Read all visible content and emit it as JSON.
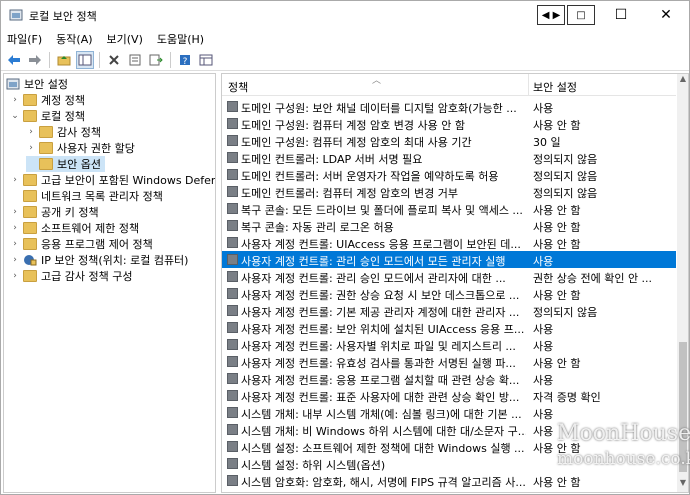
{
  "window": {
    "title": "로컬 보안 정책"
  },
  "titlebar_buttons": {
    "arrows": "◀ ▶",
    "maximize_box": "□",
    "minimize": "—",
    "maximize": "☐",
    "close": "✕"
  },
  "menu": [
    "파일(F)",
    "동작(A)",
    "보기(V)",
    "도움말(H)"
  ],
  "toolbar_icons": [
    "back-icon",
    "forward-icon",
    "up-folder-icon",
    "show-tree-icon",
    "delete-icon",
    "properties-icon",
    "export-icon",
    "help-icon",
    "view-icon"
  ],
  "tree": [
    {
      "label": "보안 설정",
      "level": 0,
      "exp": "",
      "icon": "security-icon"
    },
    {
      "label": "계정 정책",
      "level": 1,
      "exp": "›",
      "icon": "folder-icon"
    },
    {
      "label": "로컬 정책",
      "level": 1,
      "exp": "⌄",
      "icon": "folder-icon"
    },
    {
      "label": "감사 정책",
      "level": 2,
      "exp": "›",
      "icon": "folder-icon"
    },
    {
      "label": "사용자 권한 할당",
      "level": 2,
      "exp": "›",
      "icon": "folder-icon"
    },
    {
      "label": "보안 옵션",
      "level": 2,
      "exp": "",
      "icon": "folder-icon",
      "selected": true
    },
    {
      "label": "고급 보안이 포함된 Windows Defende",
      "level": 1,
      "exp": "›",
      "icon": "folder-icon"
    },
    {
      "label": "네트워크 목록 관리자 정책",
      "level": 1,
      "exp": "",
      "icon": "folder-icon"
    },
    {
      "label": "공개 키 정책",
      "level": 1,
      "exp": "›",
      "icon": "folder-icon"
    },
    {
      "label": "소프트웨어 제한 정책",
      "level": 1,
      "exp": "›",
      "icon": "folder-icon"
    },
    {
      "label": "응용 프로그램 제어 정책",
      "level": 1,
      "exp": "›",
      "icon": "folder-icon"
    },
    {
      "label": "IP 보안 정책(위치: 로컬 컴퓨터)",
      "level": 1,
      "exp": "›",
      "icon": "ip-security-icon"
    },
    {
      "label": "고급 감사 정책 구성",
      "level": 1,
      "exp": "›",
      "icon": "folder-icon"
    }
  ],
  "list": {
    "columns": [
      "정책",
      "보안 설정"
    ],
    "rows": [
      {
        "policy": "도메인 구성원: 보안 채널 데이터를 디지털 암호화(가능한 ...",
        "setting": "사용"
      },
      {
        "policy": "도메인 구성원: 컴퓨터 계정 암호 변경 사용 안 함",
        "setting": "사용 안 함"
      },
      {
        "policy": "도메인 구성원: 컴퓨터 계정 암호의 최대 사용 기간",
        "setting": "30 일"
      },
      {
        "policy": "도메인 컨트롤러: LDAP 서버 서명 필요",
        "setting": "정의되지 않음"
      },
      {
        "policy": "도메인 컨트롤러: 서버 운영자가 작업을 예약하도록 허용",
        "setting": "정의되지 않음"
      },
      {
        "policy": "도메인 컨트롤러: 컴퓨터 계정 암호의 변경 거부",
        "setting": "정의되지 않음"
      },
      {
        "policy": "복구 콘솔: 모든 드라이브 및 폴더에 플로피 복사 및 액세스 ...",
        "setting": "사용 안 함"
      },
      {
        "policy": "복구 콘솔: 자동 관리 로그온 허용",
        "setting": "사용 안 함"
      },
      {
        "policy": "사용자 계정 컨트롤: UIAccess 응용 프로그램이 보안된 데...",
        "setting": "사용 안 함"
      },
      {
        "policy": "사용자 계정 컨트롤: 관리 승인 모드에서 모든 관리자 실행",
        "setting": "사용",
        "selected": true
      },
      {
        "policy": "사용자 계정 컨트롤: 관리 승인 모드에서 관리자에 대한 ...",
        "setting": "권한 상승 전에 확인 안 ..."
      },
      {
        "policy": "사용자 계정 컨트롤: 권한 상승 요청 시 보안 데스크톱으로 ...",
        "setting": "사용 안 함"
      },
      {
        "policy": "사용자 계정 컨트롤: 기본 제공 관리자 계정에 대한 관리자 ...",
        "setting": "정의되지 않음"
      },
      {
        "policy": "사용자 계정 컨트롤: 보안 위치에 설치된 UIAccess 응용 프...",
        "setting": "사용"
      },
      {
        "policy": "사용자 계정 컨트롤: 사용자별 위치로 파일 및 레지스트리 ...",
        "setting": "사용"
      },
      {
        "policy": "사용자 계정 컨트롤: 유효성 검사를 통과한 서명된 실행 파...",
        "setting": "사용 안 함"
      },
      {
        "policy": "사용자 계정 컨트롤: 응용 프로그램 설치할 때 관련 상승 확...",
        "setting": "사용"
      },
      {
        "policy": "사용자 계정 컨트롤: 표준 사용자에 대한 관련 상승 확인 방...",
        "setting": "자격 증명 확인"
      },
      {
        "policy": "시스템 개체: 내부 시스템 개체(예: 심볼 링크)에 대한 기본 ...",
        "setting": "사용"
      },
      {
        "policy": "시스템 개체: 비 Windows 하위 시스템에 대한 대/소문자 구...",
        "setting": "사용"
      },
      {
        "policy": "시스템 설정: 소프트웨어 제한 정책에 대한 Windows 실행 ...",
        "setting": "사용 안 함"
      },
      {
        "policy": "시스템 설정: 하위 시스템(옵션)",
        "setting": ""
      },
      {
        "policy": "시스템 암호화: 암호화, 해시, 서명에 FIPS 규격 알고리즘 사...",
        "setting": "사용 안 함"
      }
    ]
  },
  "watermark": {
    "line1": "MoonHouse",
    "line2": "moonhouse.co.kr"
  },
  "colors": {
    "selection": "#0078d7",
    "tree_selection": "#cce4f7",
    "folder": "#e8c15a"
  }
}
